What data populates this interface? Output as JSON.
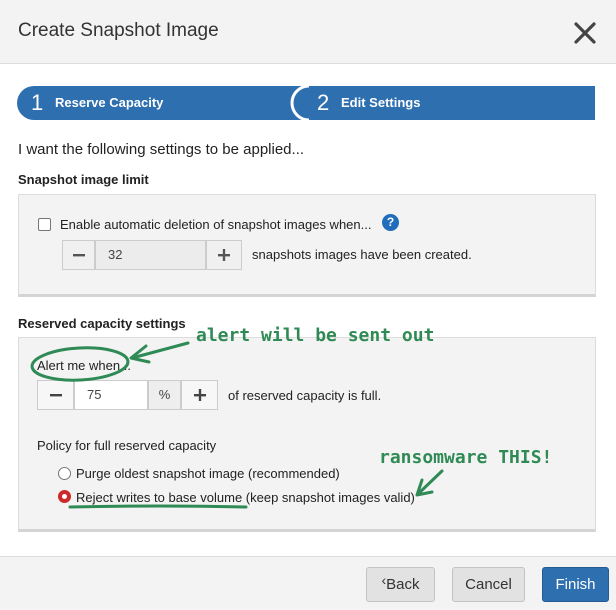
{
  "dialog": {
    "title": "Create Snapshot Image"
  },
  "wizard": {
    "steps": [
      {
        "number": "1",
        "label": "Reserve Capacity"
      },
      {
        "number": "2",
        "label": "Edit Settings"
      }
    ],
    "active_step": 2
  },
  "intro": "I want the following settings to be applied...",
  "snapshot_limit": {
    "title": "Snapshot image limit",
    "checkbox_label": "Enable automatic deletion of snapshot images when...",
    "checked": false,
    "help_icon": "?",
    "value": "32",
    "suffix": "snapshots images have been created."
  },
  "reserved": {
    "title": "Reserved capacity settings",
    "alert_label": "Alert me when...",
    "alert_value": "75",
    "unit": "%",
    "alert_suffix": "of reserved capacity is full.",
    "policy_label": "Policy for full reserved capacity",
    "options": [
      {
        "label": "Purge oldest snapshot image (recommended)",
        "checked": false
      },
      {
        "label": "Reject writes to base volume (keep snapshot images valid)",
        "checked": true
      }
    ]
  },
  "annotations": {
    "top": "alert will be sent out",
    "bottom": "ransomware THIS!",
    "color": "#2f8a55"
  },
  "footer": {
    "back": "Back",
    "back_icon": "‹",
    "cancel": "Cancel",
    "finish": "Finish"
  },
  "colors": {
    "step_bar": "#2e6fb0",
    "primary_button": "#2e6fb0",
    "radio_checked": "#cc2b2b",
    "help_icon": "#1f6dbb"
  },
  "icons": {
    "close": "close-icon",
    "help": "question-icon",
    "minus": "minus-icon",
    "plus": "plus-icon",
    "back": "chevron-left-icon"
  }
}
